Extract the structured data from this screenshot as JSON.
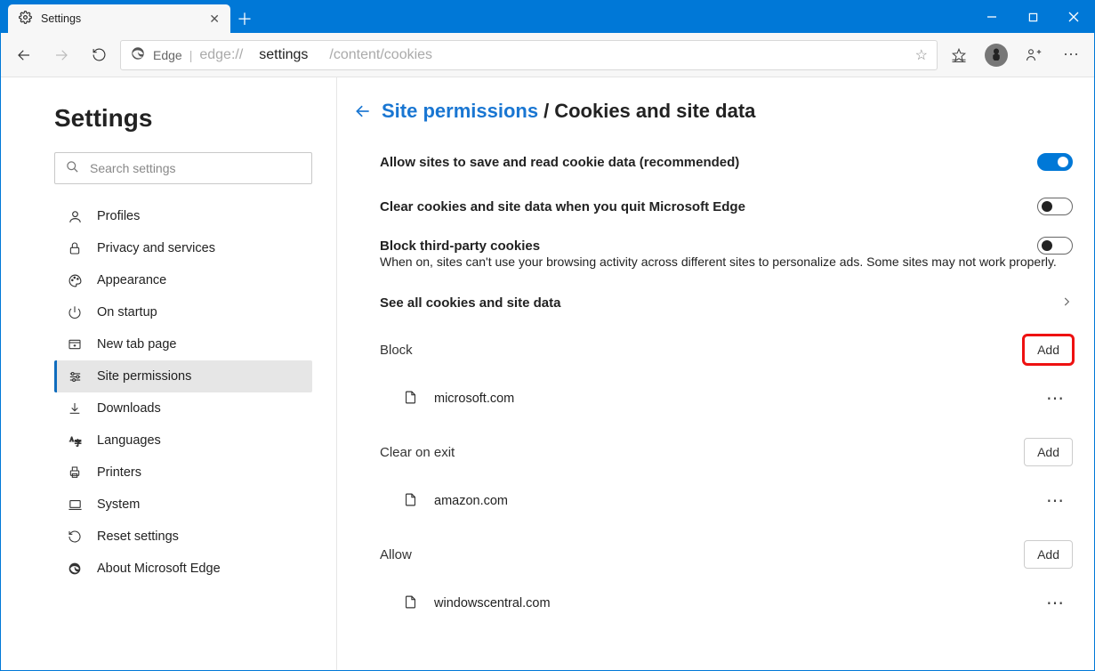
{
  "window": {
    "tab_title": "Settings"
  },
  "toolbar": {
    "product_name": "Edge",
    "url_prefix": "edge://",
    "url_main": "settings",
    "url_rest": "/content/cookies"
  },
  "sidebar": {
    "heading": "Settings",
    "search_placeholder": "Search settings",
    "items": [
      {
        "label": "Profiles"
      },
      {
        "label": "Privacy and services"
      },
      {
        "label": "Appearance"
      },
      {
        "label": "On startup"
      },
      {
        "label": "New tab page"
      },
      {
        "label": "Site permissions"
      },
      {
        "label": "Downloads"
      },
      {
        "label": "Languages"
      },
      {
        "label": "Printers"
      },
      {
        "label": "System"
      },
      {
        "label": "Reset settings"
      },
      {
        "label": "About Microsoft Edge"
      }
    ]
  },
  "main": {
    "breadcrumb_link": "Site permissions",
    "breadcrumb_sep": "/",
    "breadcrumb_current": "Cookies and site data",
    "items": {
      "allow_cookies": {
        "label": "Allow sites to save and read cookie data (recommended)",
        "on": true
      },
      "clear_on_quit": {
        "label": "Clear cookies and site data when you quit Microsoft Edge",
        "on": false
      },
      "block_third_party": {
        "label": "Block third-party cookies",
        "desc": "When on, sites can't use your browsing activity across different sites to personalize ads. Some sites may not work properly.",
        "on": false
      },
      "see_all": {
        "label": "See all cookies and site data"
      }
    },
    "sections": {
      "block": {
        "label": "Block",
        "add": "Add",
        "sites": [
          {
            "name": "microsoft.com"
          }
        ]
      },
      "clear_on_exit": {
        "label": "Clear on exit",
        "add": "Add",
        "sites": [
          {
            "name": "amazon.com"
          }
        ]
      },
      "allow": {
        "label": "Allow",
        "add": "Add",
        "sites": [
          {
            "name": "windowscentral.com"
          }
        ]
      }
    }
  }
}
